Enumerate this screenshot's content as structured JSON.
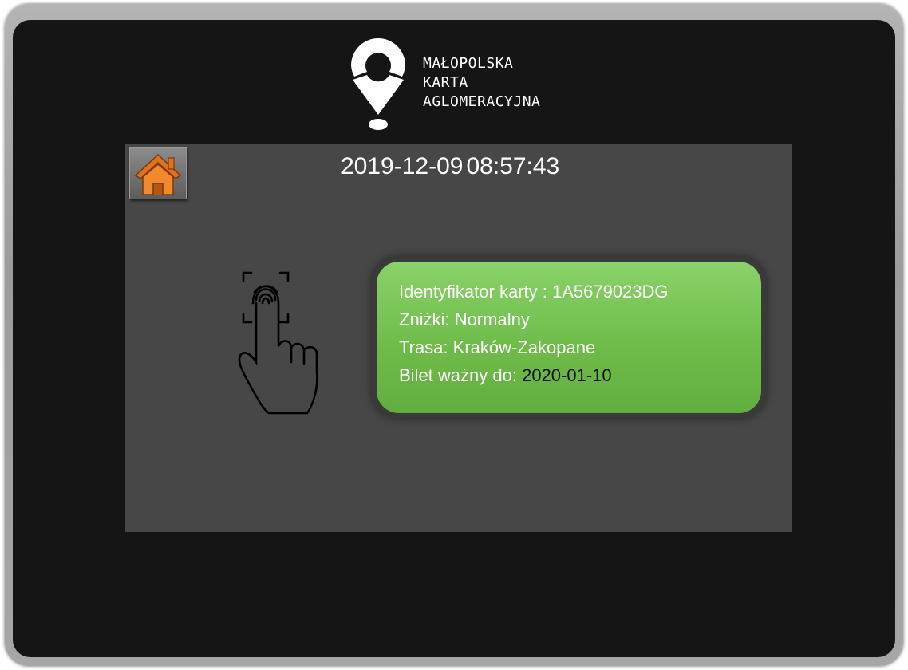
{
  "logo": {
    "line1": "MAŁOPOLSKA",
    "line2": "KARTA",
    "line3": "AGLOMERACYJNA"
  },
  "header": {
    "date": "2019-12-09",
    "time": "08:57:43"
  },
  "icons": {
    "home": "home-icon",
    "fingerprint": "fingerprint-touch-icon"
  },
  "card": {
    "id_label": "Identyfikator karty :",
    "id_value": "1A5679023DG",
    "discount_label": "Zniżki:",
    "discount_value": "Normalny",
    "route_label": "Trasa:",
    "route_value": "Kraków-Zakopane",
    "valid_label": "Bilet ważny do:",
    "valid_value": "2020-01-10"
  },
  "colors": {
    "screen_bg": "#151515",
    "panel_bg": "#474747",
    "card_green": "#70bd4b",
    "home_orange": "#e0711e"
  }
}
